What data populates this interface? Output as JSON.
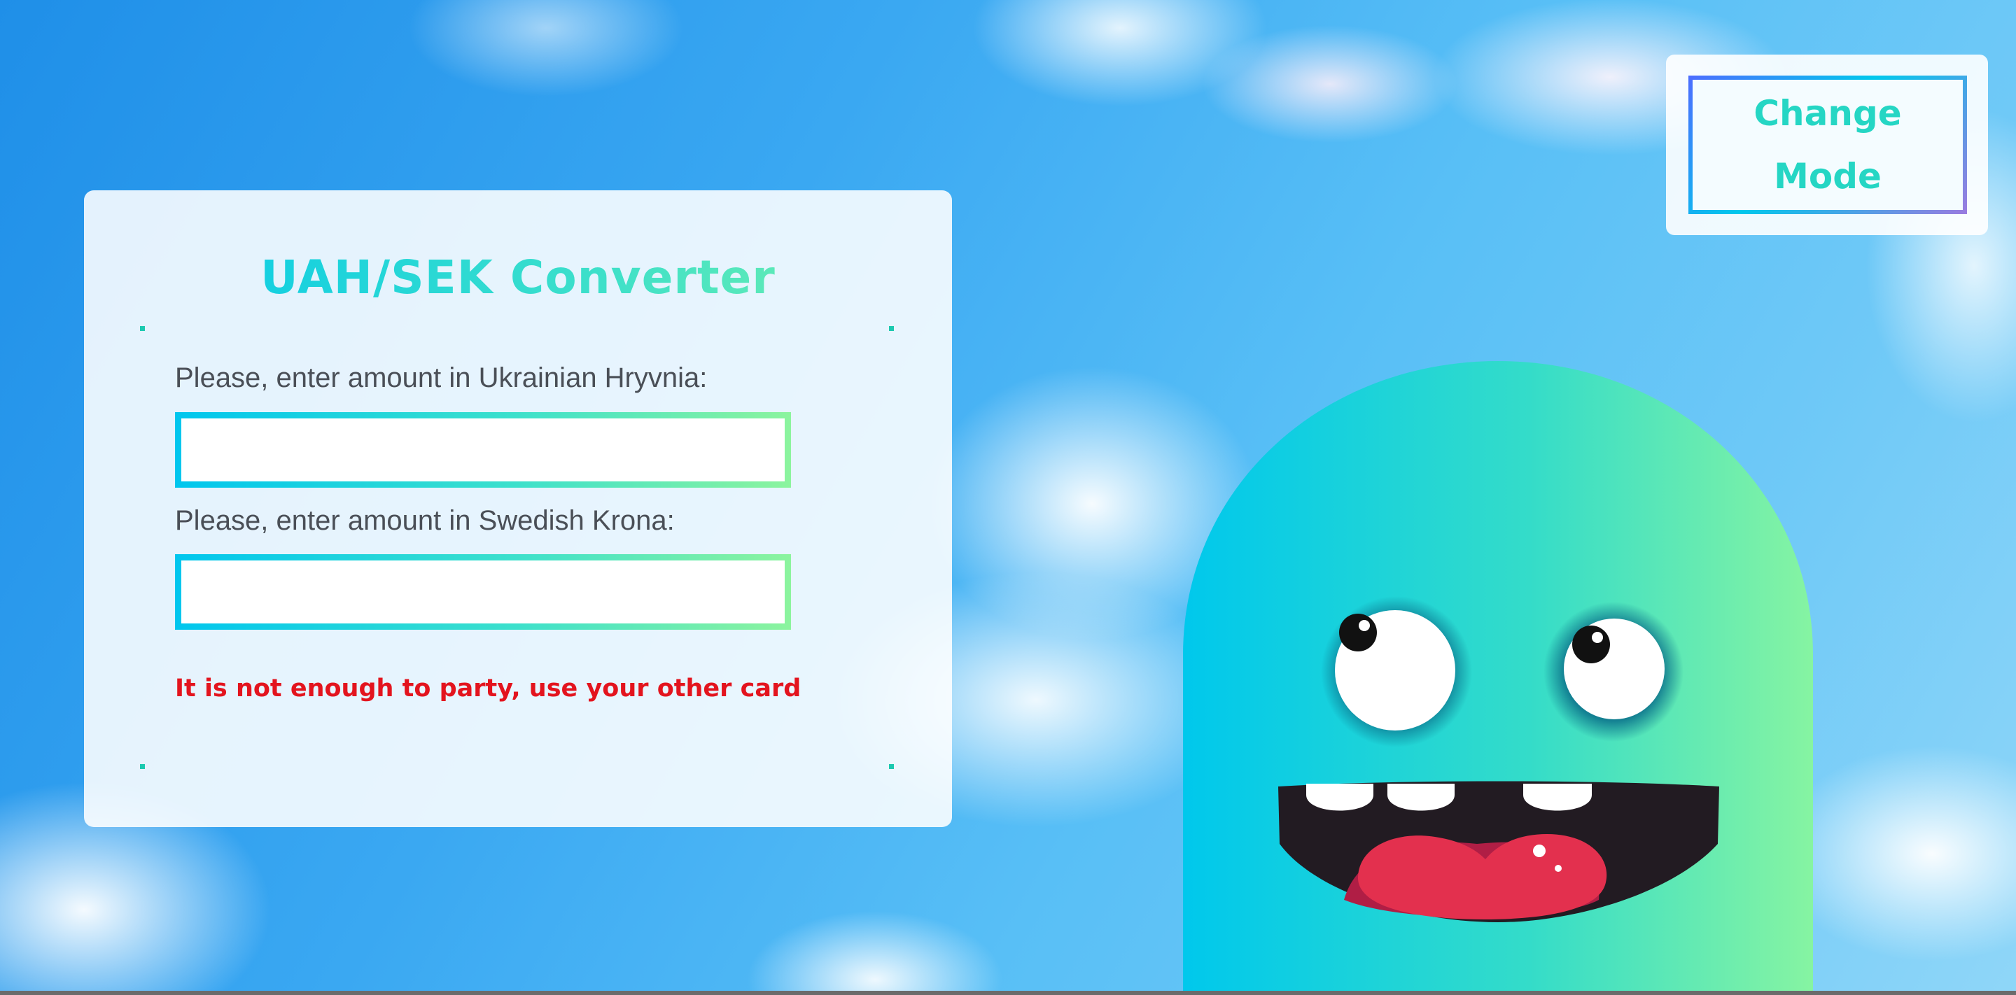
{
  "converter": {
    "title": "UAH/SEK Converter",
    "uah_label": "Please, enter amount in Ukrainian Hryvnia:",
    "uah_value": "",
    "sek_label": "Please, enter amount in Swedish Krona:",
    "sek_value": "",
    "warning": "It is not enough to party, use your other card"
  },
  "mode_button": {
    "line1": "Change",
    "line2": "Mode"
  },
  "colors": {
    "accent_start": "#00c8ec",
    "accent_end": "#79f2a8",
    "warning": "#e3141e",
    "monster_body": "#2fd8d0"
  },
  "icons": {
    "mascot": "smiling-monster-illustration"
  }
}
